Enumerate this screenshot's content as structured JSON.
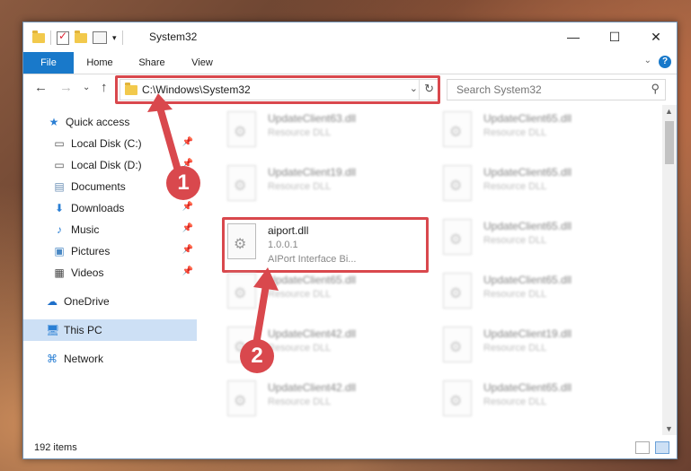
{
  "window": {
    "title": "System32",
    "minimize": "—",
    "maximize": "☐",
    "close": "✕"
  },
  "ribbon": {
    "tabs": [
      "File",
      "Home",
      "Share",
      "View"
    ],
    "help": "?"
  },
  "address": {
    "path": "C:\\Windows\\System32"
  },
  "search": {
    "placeholder": "Search System32"
  },
  "sidebar": {
    "items": [
      {
        "label": "Quick access",
        "icon": "star-icon"
      },
      {
        "label": "Local Disk (C:)",
        "icon": "drive-icon",
        "pinned": true
      },
      {
        "label": "Local Disk (D:)",
        "icon": "drive-icon",
        "pinned": true
      },
      {
        "label": "Documents",
        "icon": "documents-icon",
        "pinned": true
      },
      {
        "label": "Downloads",
        "icon": "downloads-icon",
        "pinned": true
      },
      {
        "label": "Music",
        "icon": "music-icon",
        "pinned": true
      },
      {
        "label": "Pictures",
        "icon": "pictures-icon",
        "pinned": true
      },
      {
        "label": "Videos",
        "icon": "videos-icon",
        "pinned": true
      },
      {
        "label": "OneDrive",
        "icon": "cloud-icon"
      },
      {
        "label": "This PC",
        "icon": "computer-icon",
        "selected": true
      },
      {
        "label": "Network",
        "icon": "network-icon"
      }
    ]
  },
  "files": [
    {
      "name": "UpdateClient63.dll",
      "desc": "Resource DLL"
    },
    {
      "name": "UpdateClient65.dll",
      "desc": "Resource DLL"
    },
    {
      "name": "UpdateClient19.dll",
      "desc": "Resource DLL"
    },
    {
      "name": "UpdateClient65.dll",
      "desc": "Resource DLL"
    },
    {
      "name": "aiport.dll",
      "version": "1.0.0.1",
      "desc": "AIPort Interface Bi..."
    },
    {
      "name": "UpdateClient65.dll",
      "desc": "Resource DLL"
    },
    {
      "name": "UpdateClient65.dll",
      "desc": "Resource DLL"
    },
    {
      "name": "UpdateClient65.dll",
      "desc": "Resource DLL"
    },
    {
      "name": "UpdateClient42.dll",
      "desc": "Resource DLL"
    },
    {
      "name": "UpdateClient19.dll",
      "desc": "Resource DLL"
    },
    {
      "name": "UpdateClient42.dll",
      "desc": "Resource DLL"
    },
    {
      "name": "UpdateClient65.dll",
      "desc": "Resource DLL"
    }
  ],
  "status": {
    "count": "192 items"
  },
  "callouts": [
    "1",
    "2"
  ],
  "colors": {
    "accent": "#1979ca",
    "highlight": "#d9484d"
  }
}
